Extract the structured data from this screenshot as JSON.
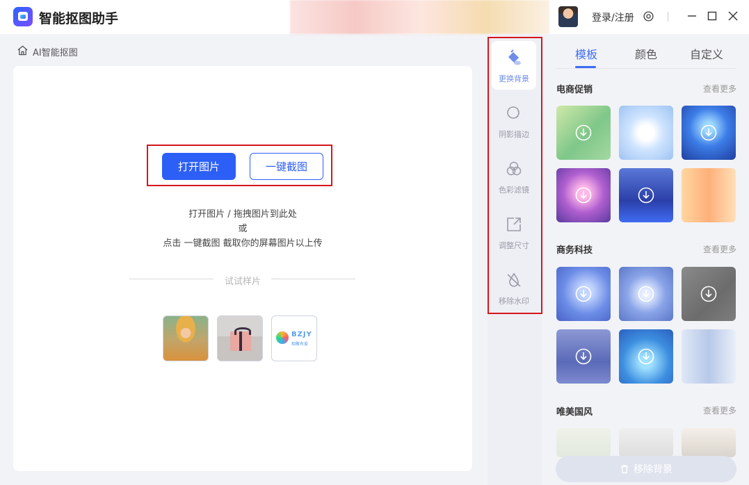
{
  "app": {
    "title": "智能抠图助手"
  },
  "header": {
    "login_label": "登录/注册"
  },
  "breadcrumb": {
    "label": "AI智能抠图"
  },
  "workspace": {
    "open_button": "打开图片",
    "capture_button": "一键截图",
    "hint_line1": "打开图片 / 拖拽图片到此处",
    "hint_line2": "或",
    "hint_line3": "点击 一键截图 截取你的屏幕图片以上传",
    "samples_label": "试试样片",
    "sample3_text": "BZJY",
    "sample3_sub": "相聚有爱"
  },
  "tools": [
    {
      "label": "更换背景",
      "icon": "paint-bucket-icon",
      "active": true
    },
    {
      "label": "阴影描边",
      "icon": "shadow-circle-icon",
      "active": false
    },
    {
      "label": "色彩滤镜",
      "icon": "color-filter-icon",
      "active": false
    },
    {
      "label": "调整尺寸",
      "icon": "resize-icon",
      "active": false
    },
    {
      "label": "移除水印",
      "icon": "remove-watermark-icon",
      "active": false
    }
  ],
  "tabs": [
    {
      "label": "模板",
      "active": true
    },
    {
      "label": "颜色",
      "active": false
    },
    {
      "label": "自定义",
      "active": false
    }
  ],
  "sections": [
    {
      "title": "电商促销",
      "more": "查看更多"
    },
    {
      "title": "商务科技",
      "more": "查看更多"
    },
    {
      "title": "唯美国风",
      "more": "查看更多"
    }
  ],
  "footer": {
    "remove_bg_label": "移除背景"
  },
  "colors": {
    "accent": "#2c5ff6",
    "highlight_box": "#d4161c",
    "active_tab": "#3f6cf3"
  }
}
